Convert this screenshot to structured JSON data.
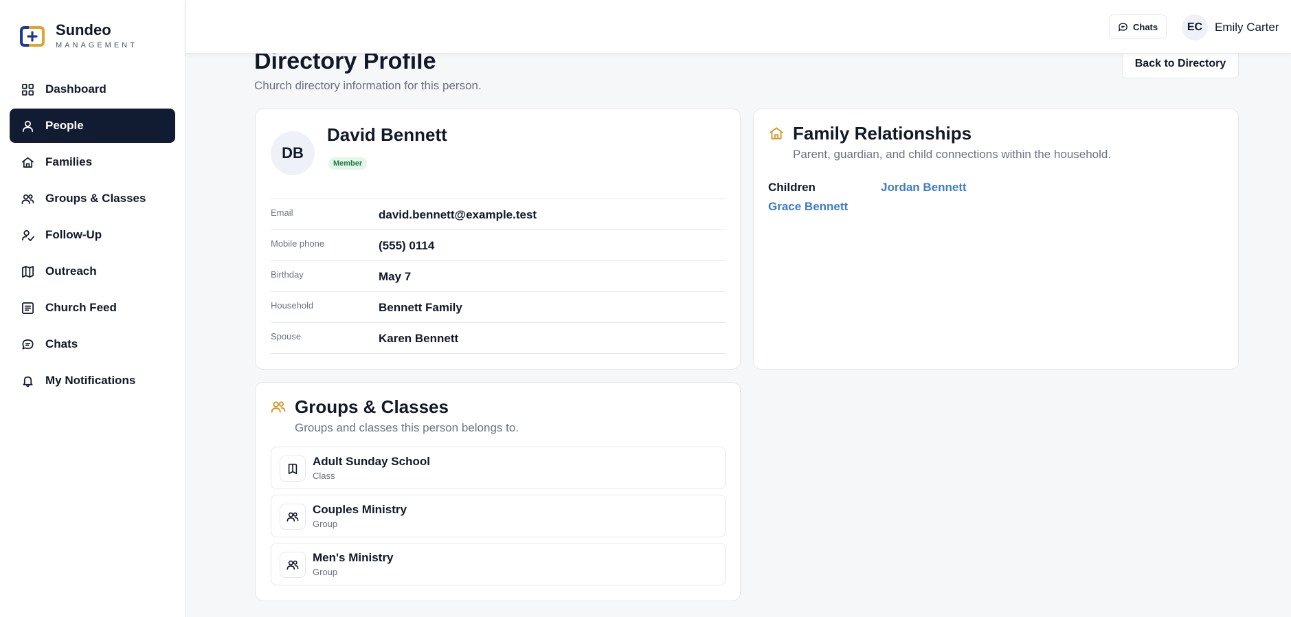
{
  "brand": {
    "name": "Sundeo",
    "subtitle": "MANAGEMENT"
  },
  "sidebar": {
    "items": [
      {
        "label": "Dashboard",
        "icon": "grid-icon"
      },
      {
        "label": "People",
        "icon": "user-icon",
        "active": true
      },
      {
        "label": "Families",
        "icon": "house-icon"
      },
      {
        "label": "Groups & Classes",
        "icon": "users-icon"
      },
      {
        "label": "Follow-Up",
        "icon": "user-follow-icon"
      },
      {
        "label": "Outreach",
        "icon": "map-icon"
      },
      {
        "label": "Church Feed",
        "icon": "feed-icon"
      },
      {
        "label": "Chats",
        "icon": "chat-icon"
      },
      {
        "label": "My Notifications",
        "icon": "bell-icon"
      }
    ]
  },
  "header": {
    "chats_label": "Chats",
    "user": {
      "initials": "EC",
      "name": "Emily Carter"
    }
  },
  "page": {
    "title": "Directory Profile",
    "subtitle": "Church directory information for this person.",
    "back_label": "Back to Directory"
  },
  "profile": {
    "initials": "DB",
    "name": "David Bennett",
    "badge": "Member",
    "fields": [
      {
        "label": "Email",
        "value": "david.bennett@example.test"
      },
      {
        "label": "Mobile phone",
        "value": "(555) 0114"
      },
      {
        "label": "Birthday",
        "value": "May 7"
      },
      {
        "label": "Household",
        "value": "Bennett Family"
      },
      {
        "label": "Spouse",
        "value": "Karen Bennett"
      }
    ]
  },
  "family": {
    "title": "Family Relationships",
    "subtitle": "Parent, guardian, and child connections within the household.",
    "children_label": "Children",
    "children": [
      "Jordan Bennett",
      "Grace Bennett"
    ]
  },
  "groups": {
    "title": "Groups & Classes",
    "subtitle": "Groups and classes this person belongs to.",
    "items": [
      {
        "name": "Adult Sunday School",
        "type": "Class",
        "icon": "book-icon"
      },
      {
        "name": "Couples Ministry",
        "type": "Group",
        "icon": "users-icon"
      },
      {
        "name": "Men's Ministry",
        "type": "Group",
        "icon": "users-icon"
      }
    ]
  },
  "colors": {
    "accent": "#d69a2d",
    "nav_active": "#111c33",
    "link": "#3b7bd0",
    "badge_bg": "#e6f4ea",
    "badge_text": "#15803d"
  }
}
